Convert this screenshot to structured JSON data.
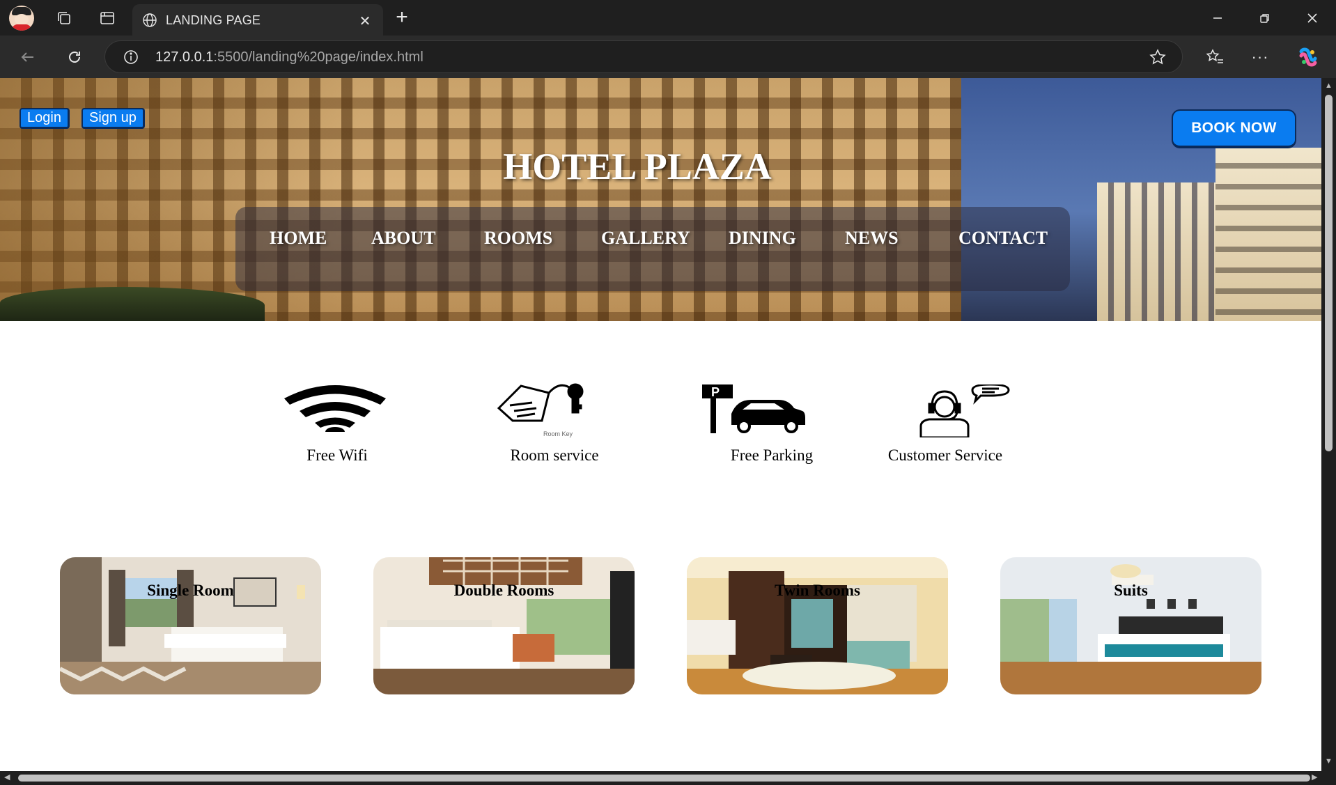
{
  "browser": {
    "tab_title": "LANDING PAGE",
    "url_host": "127.0.0.1",
    "url_path": ":5500/landing%20page/index.html"
  },
  "hero": {
    "login_label": "Login",
    "signup_label": "Sign up",
    "title": "HOTEL PLAZA",
    "book_label": "BOOK NOW",
    "nav": [
      "HOME",
      "ABOUT",
      "ROOMS",
      "GALLERY",
      "DINING",
      "NEWS",
      "CONTACT"
    ]
  },
  "features": [
    {
      "label": "Free Wifi",
      "icon": "wifi-icon"
    },
    {
      "label": "Room service",
      "icon": "room-key-icon",
      "caption": "Room Key"
    },
    {
      "label": "Free Parking",
      "icon": "parking-icon"
    },
    {
      "label": "Customer Service",
      "icon": "headset-icon"
    }
  ],
  "rooms": [
    {
      "label": "Single Room"
    },
    {
      "label": "Double Rooms"
    },
    {
      "label": "Twin Rooms"
    },
    {
      "label": "Suits"
    }
  ],
  "colors": {
    "accent": "#0a7cf0",
    "chrome_bg": "#1f1f1f",
    "toolbar_bg": "#2b2b2b"
  }
}
